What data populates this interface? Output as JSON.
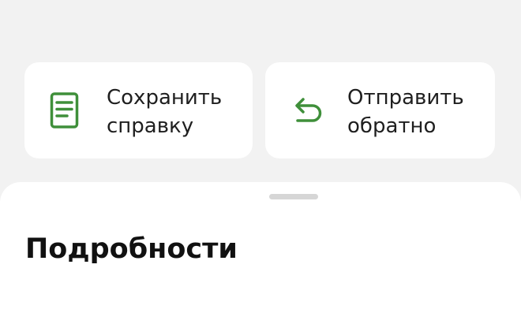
{
  "actions": {
    "save": {
      "label": "Сохранить\nсправку",
      "icon": "document-icon"
    },
    "return": {
      "label": "Отправить\nобратно",
      "icon": "return-arrow-icon"
    }
  },
  "sheet": {
    "title": "Подробности"
  },
  "colors": {
    "background": "#f2f2f2",
    "card": "#ffffff",
    "icon_accent": "#3f8f3a",
    "text": "#1f1f1f",
    "handle": "#d6d6d6"
  }
}
